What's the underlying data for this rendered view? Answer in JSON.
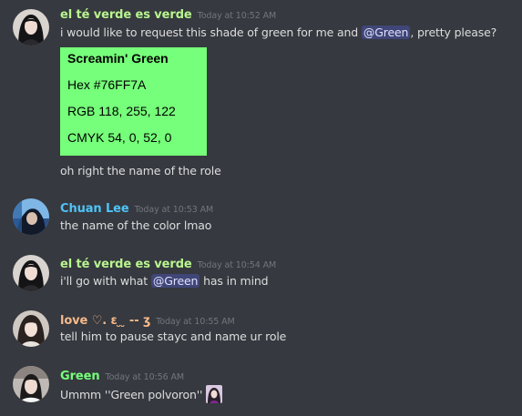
{
  "messages": [
    {
      "username": "el té verde es verde",
      "username_color": "#b9f58f",
      "timestamp": "Today at 10:52 AM",
      "text_pre": "i would like to request this shade of green for me and ",
      "mention": "@Green",
      "text_post": ", pretty please?",
      "followup": "oh right the name of the role"
    },
    {
      "username": "Chuan Lee",
      "username_color": "#4fc3f7",
      "timestamp": "Today at 10:53 AM",
      "text": "the name of the color lmao"
    },
    {
      "username": "el té verde es verde",
      "username_color": "#b9f58f",
      "timestamp": "Today at 10:54 AM",
      "text_pre": "i'll go with what ",
      "mention": "@Green",
      "text_post": " has in mind"
    },
    {
      "username": "love ♡. ɛ ̮ ̮ -- ʒ",
      "username_color": "#f5b98a",
      "timestamp": "Today at 10:55 AM",
      "text": "tell him to pause stayc and name ur role"
    },
    {
      "username": "Green",
      "username_color": "#76ff7a",
      "timestamp": "Today at 10:56 AM",
      "text": "Ummm ''Green polvoron''"
    }
  ],
  "color_card": {
    "title": "Screamin' Green",
    "hex": "Hex #76FF7A",
    "rgb": "RGB 118, 255, 122",
    "cmyk": "CMYK 54, 0, 52, 0",
    "color": "#76ff7a"
  }
}
